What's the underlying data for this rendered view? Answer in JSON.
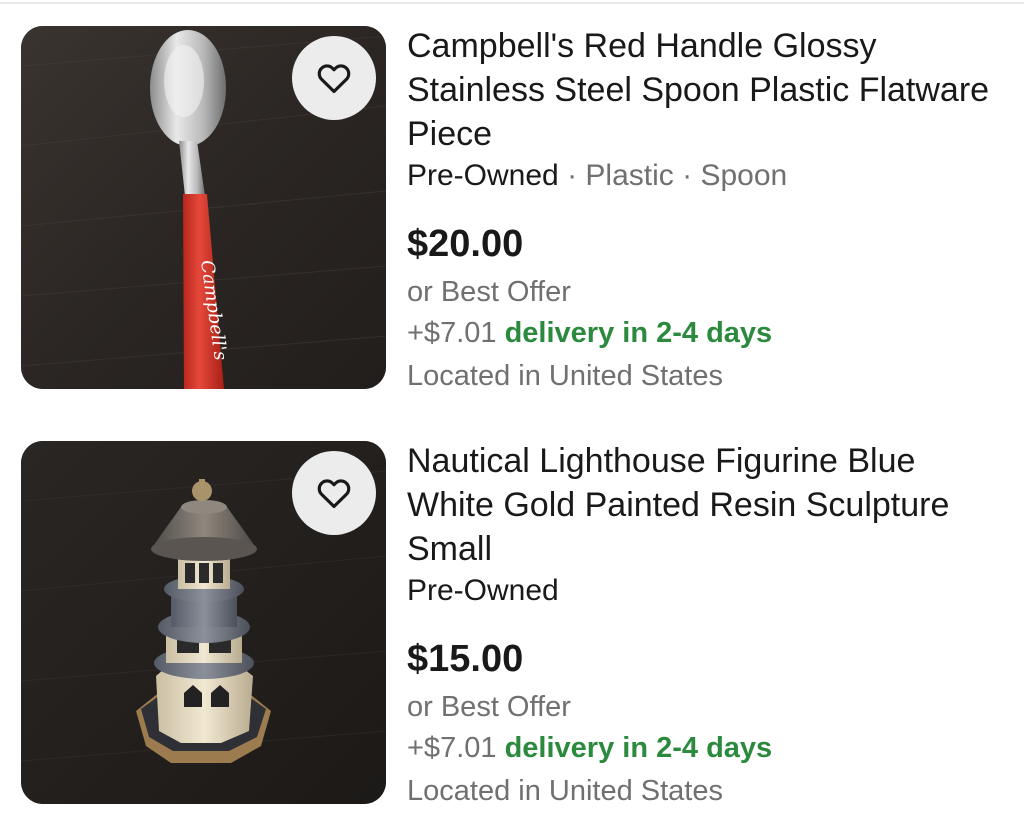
{
  "listings": [
    {
      "title": "Campbell's Red Handle Glossy Stainless Steel Spoon Plastic Flatware Piece",
      "condition": "Pre-Owned",
      "sep1": " · ",
      "material": "Plastic",
      "sep2": " · ",
      "type": "Spoon",
      "price": "$20.00",
      "best_offer": "or Best Offer",
      "shipping_cost": "+$7.01",
      "delivery": "delivery in 2-4 days",
      "location": "Located in United States",
      "image_text": "Campbell's",
      "image_icon": "spoon-image"
    },
    {
      "title": "Nautical Lighthouse Figurine Blue White Gold Painted Resin Sculpture Small",
      "condition": "Pre-Owned",
      "price": "$15.00",
      "best_offer": "or Best Offer",
      "shipping_cost": "+$7.01",
      "delivery": "delivery in 2-4 days",
      "location": "Located in United States",
      "image_icon": "lighthouse-image"
    }
  ],
  "colors": {
    "text": "#191919",
    "muted": "#707070",
    "delivery_green": "#2b8a3e",
    "heart_button_bg": "#ececec"
  },
  "icons": {
    "watch": "heart-icon"
  }
}
